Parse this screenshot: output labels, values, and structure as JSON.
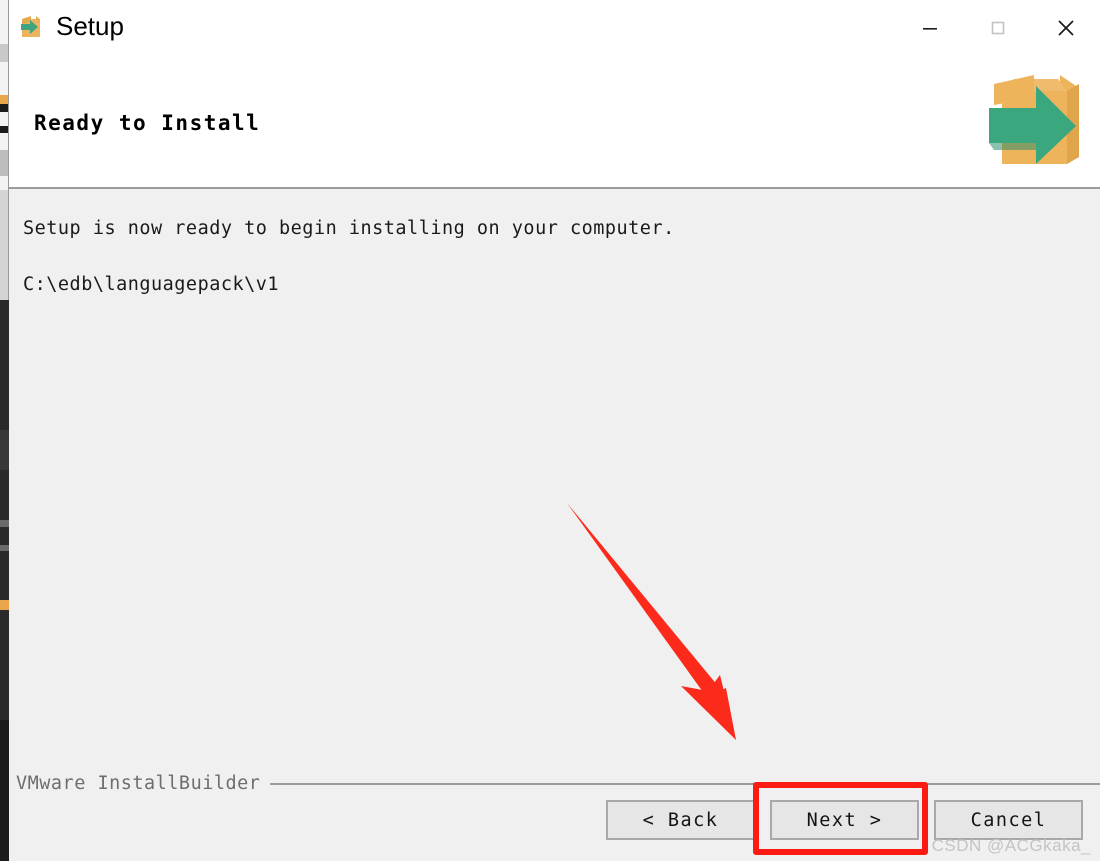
{
  "window": {
    "titlebar": {
      "title": "Setup",
      "icon": "setup-box-arrow-icon",
      "minimize_label": "—",
      "maximize_label": "□",
      "close_label": "✕"
    },
    "header": {
      "title": "Ready to Install",
      "icon": "install-box-arrow-icon"
    },
    "body": {
      "message": "Setup is now ready to begin installing on your computer.",
      "install_path": "C:\\edb\\languagepack\\v1"
    },
    "footer": {
      "brand": "VMware InstallBuilder",
      "buttons": [
        {
          "name": "back",
          "label": "< Back"
        },
        {
          "name": "next",
          "label": "Next >"
        },
        {
          "name": "cancel",
          "label": "Cancel"
        }
      ]
    }
  },
  "annotations": {
    "highlight_target": "next-button",
    "highlight_color": "#fc1b12",
    "arrow_color": "#fc2a1b",
    "watermark": "CSDN @ACGkaka_"
  },
  "colors": {
    "titlebar_bg": "#ffffff",
    "header_bg": "#ffffff",
    "body_bg": "#f0f0f0",
    "button_bg": "#e6e6e6",
    "button_border": "#a8a8a8",
    "separator": "#9c9c9c",
    "box_orange": "#eeb45c",
    "box_orange_dark": "#e0a44b",
    "arrow_green": "#4aa883"
  }
}
